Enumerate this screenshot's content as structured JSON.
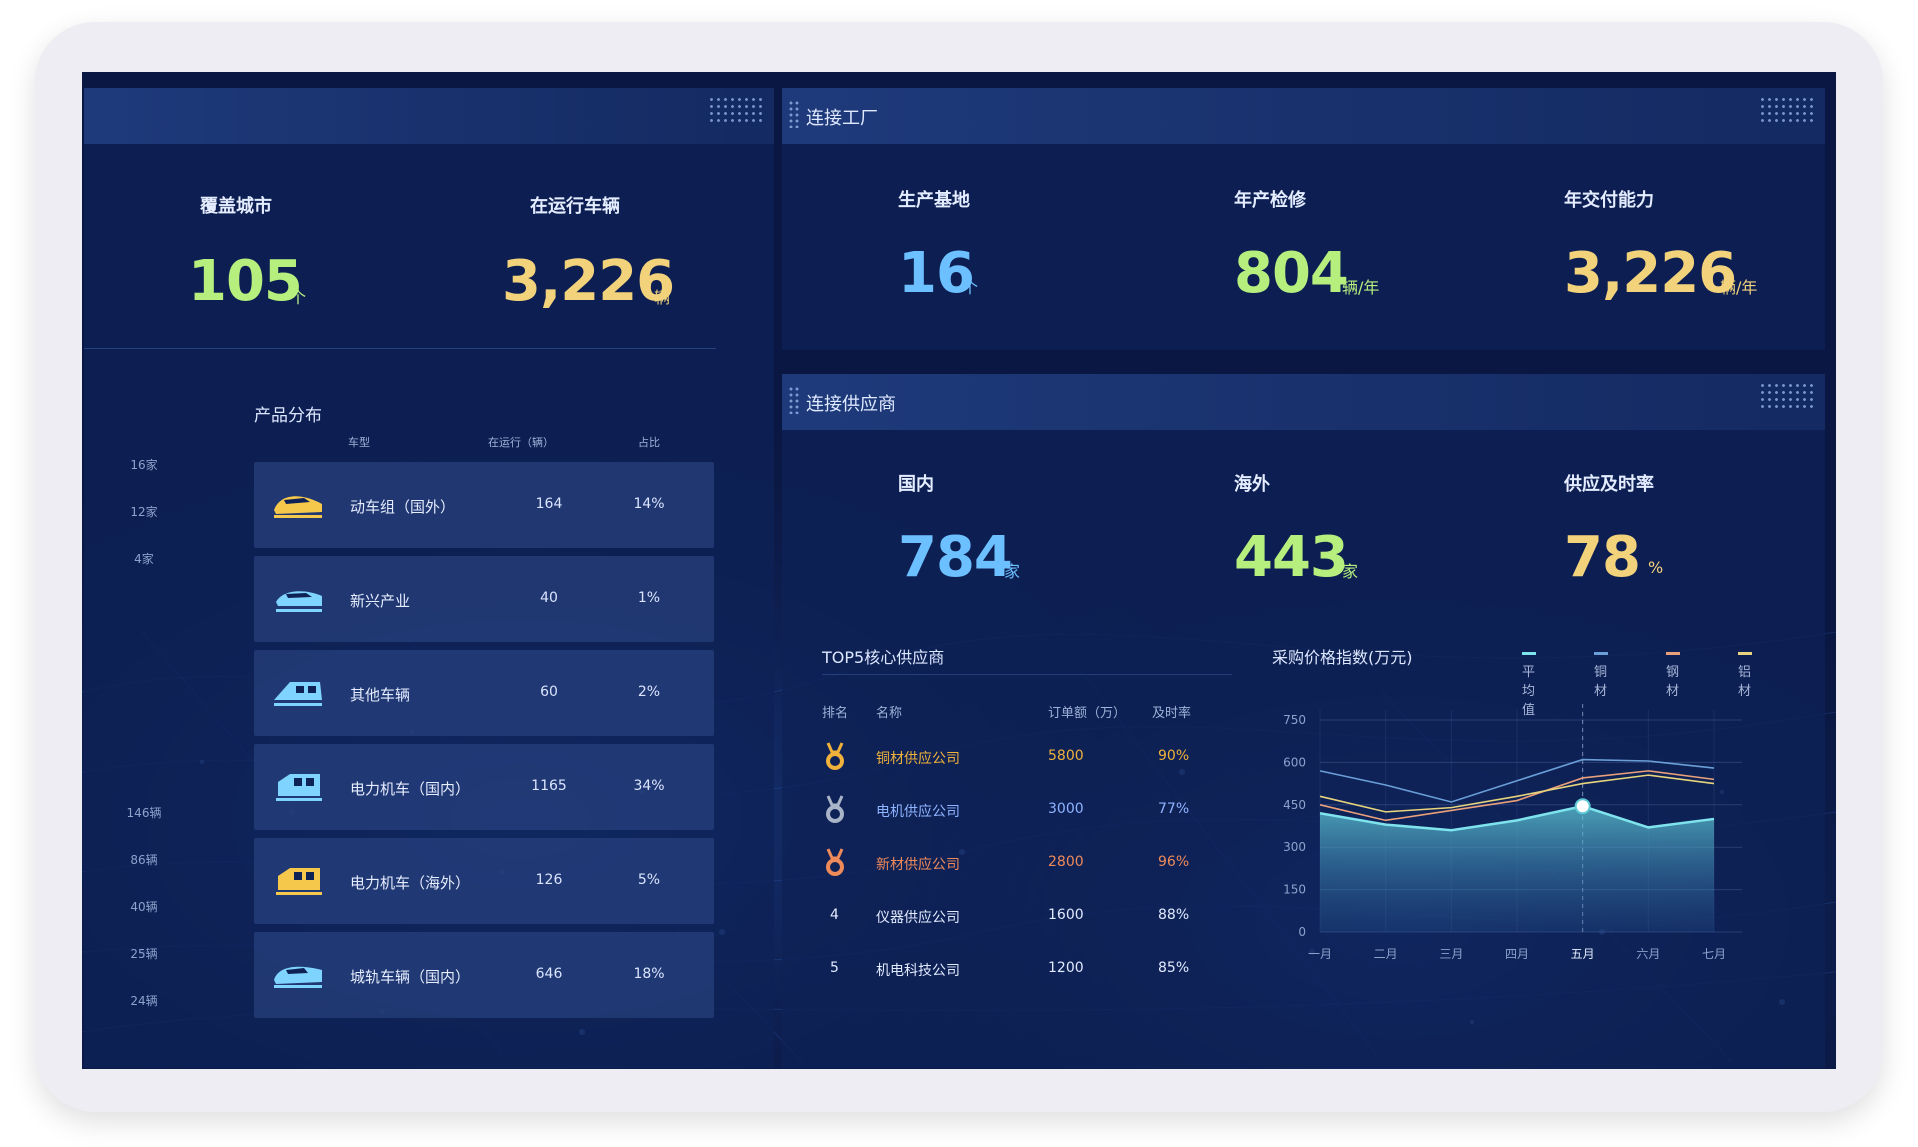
{
  "left_panel": {
    "metrics": [
      {
        "label": "覆盖城市",
        "value": "105",
        "unit": "个"
      },
      {
        "label": "在运行车辆",
        "value": "3,226",
        "unit": "辆"
      }
    ],
    "distribution": {
      "title": "产品分布",
      "col_type": "车型",
      "col_count": "在运行（辆）",
      "col_ratio": "占比",
      "axis_labels_top": [
        "16家",
        "12家",
        "4家"
      ],
      "axis_labels_bottom": [
        "146辆",
        "86辆",
        "40辆",
        "25辆",
        "24辆"
      ],
      "rows": [
        {
          "icon": "bullet-train-icon",
          "name": "动车组（国外）",
          "count": "164",
          "ratio": "14%"
        },
        {
          "icon": "maglev-train-icon",
          "name": "新兴产业",
          "count": "40",
          "ratio": "1%"
        },
        {
          "icon": "other-vehicle-icon",
          "name": "其他车辆",
          "count": "60",
          "ratio": "2%"
        },
        {
          "icon": "electric-locomotive-icon",
          "name": "电力机车（国内）",
          "count": "1165",
          "ratio": "34%"
        },
        {
          "icon": "electric-locomotive-icon",
          "name": "电力机车（海外）",
          "count": "126",
          "ratio": "5%"
        },
        {
          "icon": "metro-train-icon",
          "name": "城轨车辆（国内）",
          "count": "646",
          "ratio": "18%"
        }
      ]
    }
  },
  "factory_panel": {
    "title": "连接工厂",
    "metrics": [
      {
        "label": "生产基地",
        "value": "16",
        "unit": "个"
      },
      {
        "label": "年产检修",
        "value": "804",
        "unit": "辆/年"
      },
      {
        "label": "年交付能力",
        "value": "3,226",
        "unit": "辆/年"
      }
    ]
  },
  "supplier_panel": {
    "title": "连接供应商",
    "metrics": [
      {
        "label": "国内",
        "value": "784",
        "unit": "家"
      },
      {
        "label": "海外",
        "value": "443",
        "unit": "家"
      },
      {
        "label": "供应及时率",
        "value": "78",
        "unit": "%"
      }
    ],
    "top5": {
      "title": "TOP5核心供应商",
      "col_rank": "排名",
      "col_name": "名称",
      "col_amount": "订单额（万）",
      "col_rate": "及时率",
      "rows": [
        {
          "rank": "1",
          "name": "铜材供应公司",
          "amount": "5800",
          "rate": "90%"
        },
        {
          "rank": "2",
          "name": "电机供应公司",
          "amount": "3000",
          "rate": "77%"
        },
        {
          "rank": "3",
          "name": "新材供应公司",
          "amount": "2800",
          "rate": "96%"
        },
        {
          "rank": "4",
          "name": "仪器供应公司",
          "amount": "1600",
          "rate": "88%"
        },
        {
          "rank": "5",
          "name": "机电科技公司",
          "amount": "1200",
          "rate": "85%"
        }
      ]
    }
  },
  "colors": {
    "background": "#0a1742",
    "accent_green": "#b6ef7e",
    "accent_yellow": "#f2d27a",
    "accent_blue": "#6cc0ff",
    "medal_gold": "#f0b23a",
    "medal_silver": "#a9b4c8",
    "medal_bronze": "#ef8a5a"
  },
  "chart_data": {
    "type": "line",
    "title": "采购价格指数(万元)",
    "categories": [
      "一月",
      "二月",
      "三月",
      "四月",
      "五月",
      "六月",
      "七月"
    ],
    "ylim": [
      0,
      750
    ],
    "yticks": [
      0,
      150,
      300,
      450,
      600,
      750
    ],
    "grid": true,
    "legend_position": "top-right",
    "highlight_category": "五月",
    "series": [
      {
        "name": "平均值",
        "color": "#7fe3ee",
        "area": true,
        "values": [
          420,
          380,
          360,
          395,
          445,
          370,
          400
        ]
      },
      {
        "name": "铜材",
        "color": "#6a9fd8",
        "values": [
          570,
          520,
          460,
          535,
          610,
          605,
          580
        ]
      },
      {
        "name": "钢材",
        "color": "#e9a07a",
        "values": [
          450,
          395,
          430,
          465,
          545,
          570,
          540
        ]
      },
      {
        "name": "铝材",
        "color": "#e8d47c",
        "values": [
          480,
          425,
          440,
          480,
          525,
          555,
          525
        ]
      }
    ]
  }
}
